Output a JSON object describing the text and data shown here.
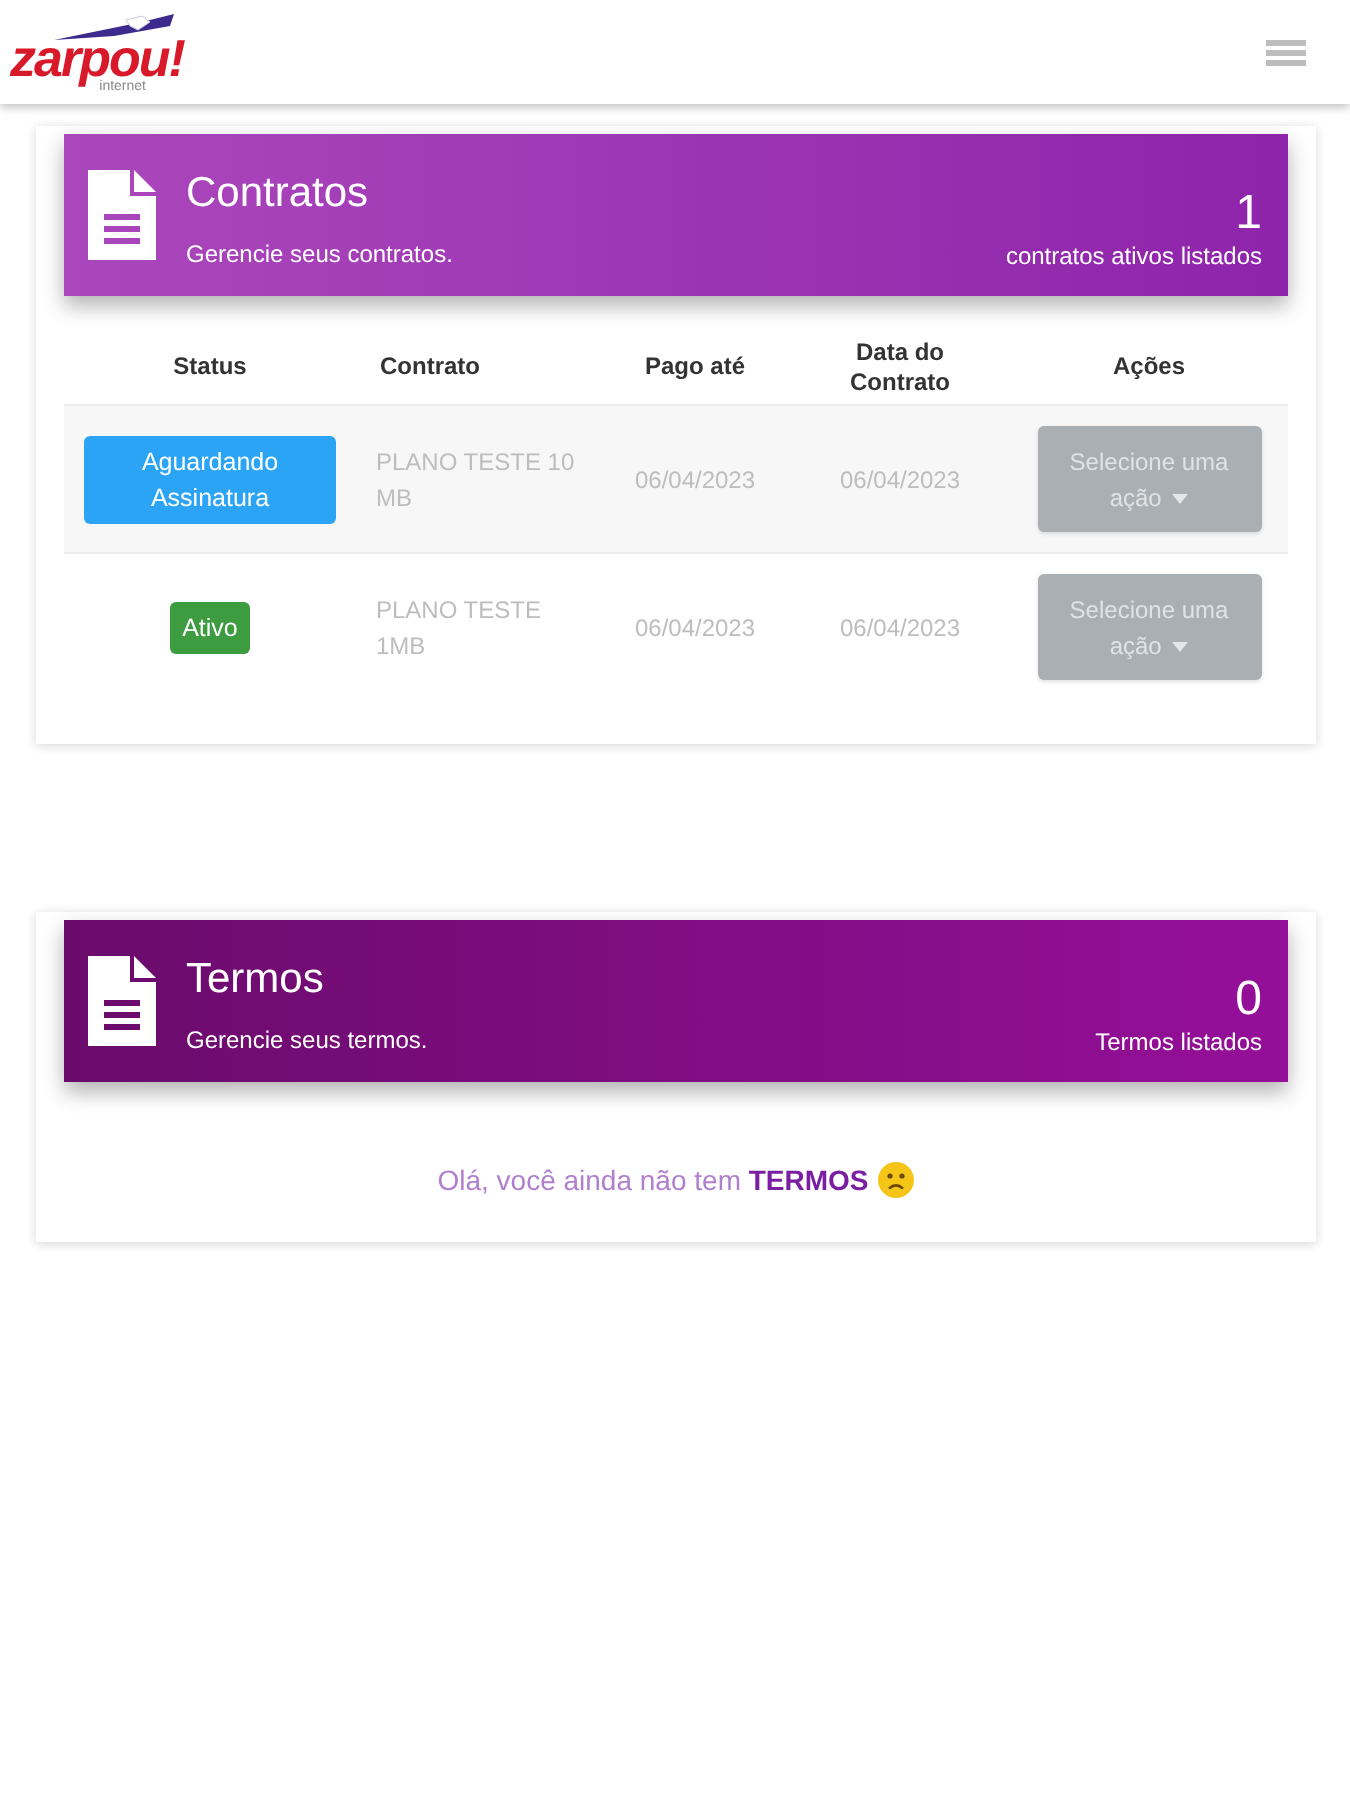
{
  "header": {
    "logo": {
      "wordmark": "zarpou!",
      "tagline": "internet"
    }
  },
  "sections": [
    {
      "kind": "table",
      "title": "Contratos",
      "subtitle": "Gerencie seus contratos.",
      "count": "1",
      "count_label": "contratos ativos listados",
      "table": {
        "columns": [
          "Status",
          "Contrato",
          "Pago até",
          "Data do Contrato",
          "Ações"
        ],
        "rows": [
          {
            "status": {
              "label": "Aguardando Assinatura",
              "color": "#2ba4f6"
            },
            "contract": "PLANO TESTE 10 MB",
            "paid_until": "06/04/2023",
            "contract_date": "06/04/2023",
            "action": "Selecione uma ação"
          },
          {
            "status": {
              "label": "Ativo",
              "color": "#3d9b40"
            },
            "contract": "PLANO TESTE 1MB",
            "paid_until": "06/04/2023",
            "contract_date": "06/04/2023",
            "action": "Selecione uma ação"
          }
        ]
      }
    },
    {
      "kind": "empty",
      "title": "Termos",
      "subtitle": "Gerencie seus termos.",
      "count": "0",
      "count_label": "Termos listados",
      "empty_message": "Olá, você ainda não tem **TERMOS**"
    }
  ]
}
